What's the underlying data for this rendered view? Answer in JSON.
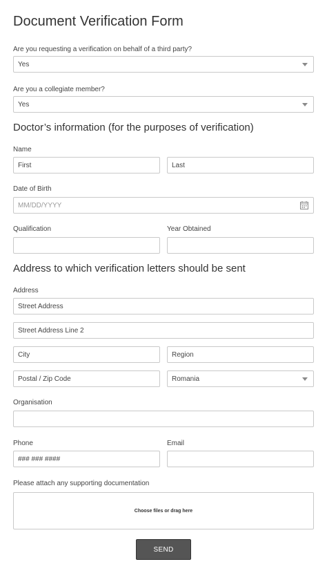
{
  "form": {
    "title": "Document Verification Form",
    "third_party": {
      "label": "Are you requesting a verification on behalf of a third party?",
      "value": "Yes"
    },
    "collegiate": {
      "label": "Are you a collegiate member?",
      "value": "Yes"
    },
    "doctor_section": "Doctor’s information (for the purposes of verification)",
    "name": {
      "label": "Name",
      "first_placeholder": "First",
      "last_placeholder": "Last"
    },
    "dob": {
      "label": "Date of Birth",
      "placeholder": "MM/DD/YYYY"
    },
    "qualification": {
      "label": "Qualification",
      "value": ""
    },
    "year_obtained": {
      "label": "Year Obtained",
      "value": ""
    },
    "address_section": "Address to which verification letters should be sent",
    "address": {
      "label": "Address",
      "street_placeholder": "Street Address",
      "street2_placeholder": "Street Address Line 2",
      "city_placeholder": "City",
      "region_placeholder": "Region",
      "postal_placeholder": "Postal / Zip Code",
      "country_value": "Romania"
    },
    "organisation": {
      "label": "Organisation",
      "value": ""
    },
    "phone": {
      "label": "Phone",
      "placeholder": "### ### ####"
    },
    "email": {
      "label": "Email",
      "value": ""
    },
    "attach": {
      "label": "Please attach any supporting documentation",
      "prompt": "Choose files or drag here"
    },
    "send_label": "SEND"
  },
  "icons": {
    "dropdown": "chevron-down-icon",
    "calendar": "calendar-icon"
  },
  "colors": {
    "border": "#c9c9c9",
    "button": "#555555",
    "text": "#333333"
  }
}
